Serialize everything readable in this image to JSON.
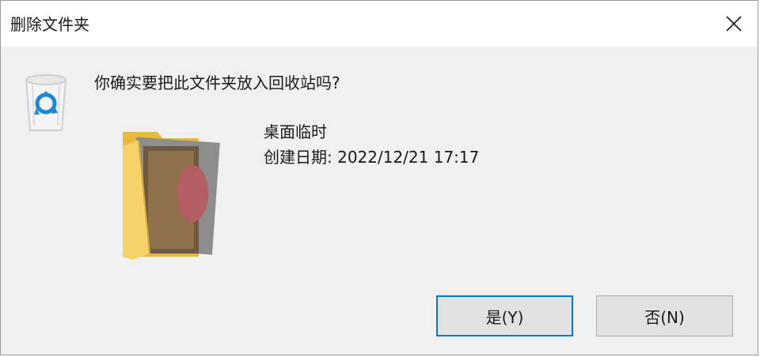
{
  "window": {
    "title": "删除文件夹",
    "close_icon": "close-icon"
  },
  "message": {
    "question": "你确实要把此文件夹放入回收站吗?"
  },
  "item": {
    "name": "桌面临时",
    "created": "创建日期: 2022/12/21 17:17",
    "icon": "folder-thumbnail-icon"
  },
  "buttons": {
    "yes_label": "是(Y)",
    "no_label": "否(N)"
  },
  "colors": {
    "accent": "#0078d7",
    "folder": "#f6d26b",
    "recycle": "#1e88d6"
  }
}
